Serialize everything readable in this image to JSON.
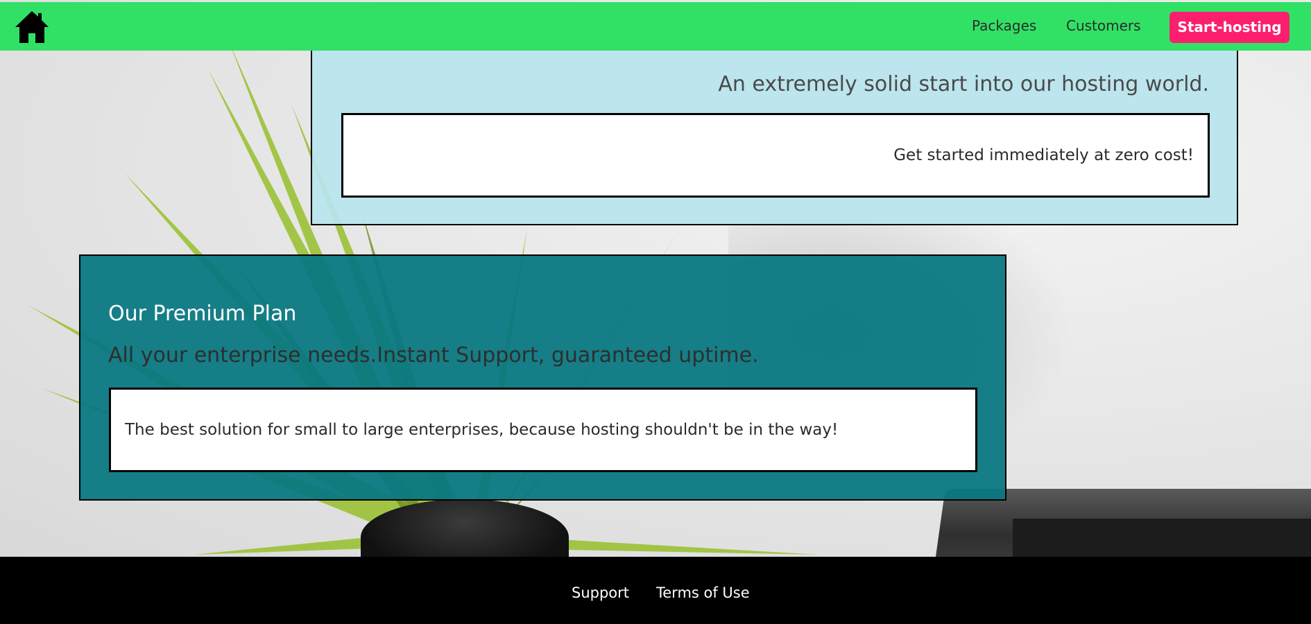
{
  "header": {
    "home_icon": "home-icon",
    "nav": [
      {
        "label": "Packages"
      },
      {
        "label": "Customers"
      }
    ],
    "cta_label": "Start-hosting"
  },
  "cards": {
    "free": {
      "tagline": "An extremely solid start into our hosting world.",
      "description": "Get started immediately at zero cost!"
    },
    "premium": {
      "title": "Our Premium Plan",
      "tagline": "All your enterprise needs.Instant Support, guaranteed uptime.",
      "description": "The best solution for small to large enterprises, because hosting shouldn't be in the way!"
    }
  },
  "footer": {
    "links": [
      {
        "label": "Support"
      },
      {
        "label": "Terms of Use"
      }
    ]
  },
  "colors": {
    "header_bg": "#31e165",
    "cta_bg": "#fb1f6e",
    "free_card_bg": "#b8e4ee",
    "premium_card_bg": "#0a7882",
    "footer_bg": "#000000"
  }
}
